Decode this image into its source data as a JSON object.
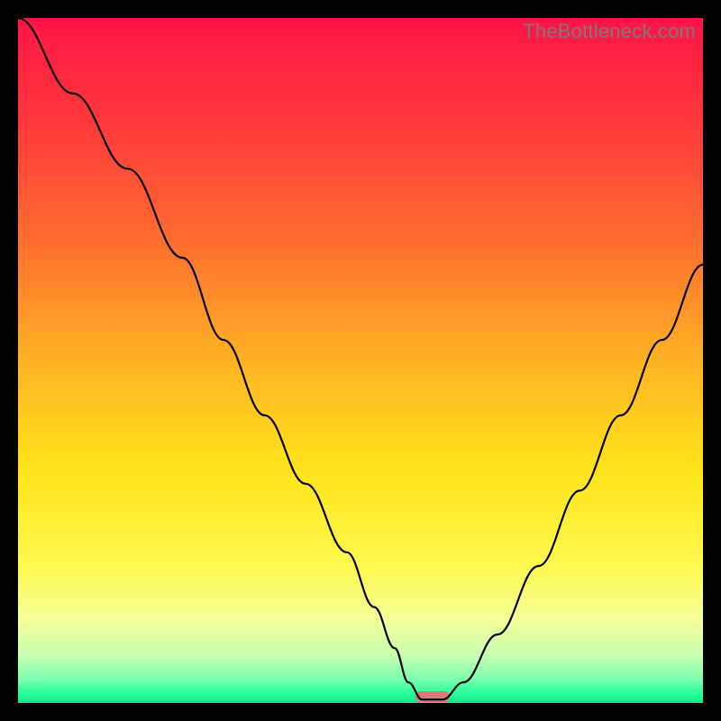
{
  "watermark": "TheBottleneck.com",
  "chart_data": {
    "type": "line",
    "title": "",
    "xlabel": "",
    "ylabel": "",
    "xlim": [
      0,
      100
    ],
    "ylim": [
      0,
      100
    ],
    "series": [
      {
        "name": "bottleneck-curve",
        "x": [
          0,
          8,
          16,
          24,
          30,
          36,
          42,
          48,
          52,
          55,
          57,
          59,
          62,
          65,
          70,
          76,
          82,
          88,
          94,
          100
        ],
        "y": [
          100,
          89,
          78,
          65,
          53,
          42,
          32,
          22,
          14,
          8,
          3,
          0.5,
          0.5,
          3,
          10,
          20,
          31,
          42,
          53,
          64
        ]
      }
    ],
    "marker": {
      "x_center": 60.5,
      "width": 5,
      "color": "#d97a7a"
    },
    "gradient_stops": [
      {
        "offset": 0.0,
        "color": "#ff1447"
      },
      {
        "offset": 0.16,
        "color": "#ff3b3b"
      },
      {
        "offset": 0.33,
        "color": "#ff6f2f"
      },
      {
        "offset": 0.5,
        "color": "#ffb224"
      },
      {
        "offset": 0.66,
        "color": "#ffe41a"
      },
      {
        "offset": 0.8,
        "color": "#fff94f"
      },
      {
        "offset": 0.88,
        "color": "#f4ff9a"
      },
      {
        "offset": 0.93,
        "color": "#c9ffb0"
      },
      {
        "offset": 0.965,
        "color": "#7dffb0"
      },
      {
        "offset": 0.985,
        "color": "#2bff9e"
      },
      {
        "offset": 1.0,
        "color": "#10e884"
      }
    ]
  }
}
